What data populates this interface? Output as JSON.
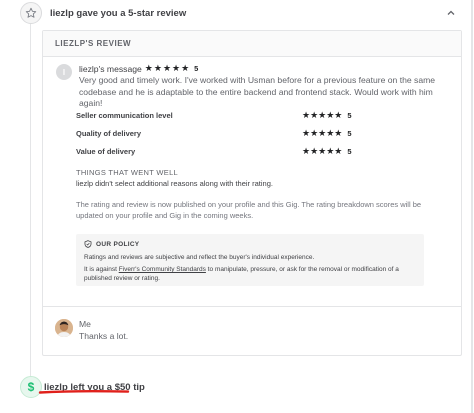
{
  "review_event": {
    "title": "liezlp gave you a 5-star review",
    "icon": "star-icon"
  },
  "review_card": {
    "header": "LIEZLP'S REVIEW",
    "reviewer_initial": "l",
    "message_label": "liezlp's message",
    "overall_rating": "5",
    "message": "Very good and timely work. I've worked with Usman before for a previous feature on the same codebase and he is adaptable to the entire backend and frontend stack. Would work with him again!",
    "criteria": [
      {
        "label": "Seller communication level",
        "value": "5"
      },
      {
        "label": "Quality of delivery",
        "value": "5"
      },
      {
        "label": "Value of delivery",
        "value": "5"
      }
    ],
    "went_well_title": "THINGS THAT WENT WELL",
    "went_well_text": "liezlp didn't select additional reasons along with their rating.",
    "publish_note": "The rating and review is now published on your profile and this Gig. The rating breakdown scores will be updated on your profile and Gig in the coming weeks.",
    "policy": {
      "title": "OUR POLICY",
      "line1": "Ratings and reviews are subjective and reflect the buyer's individual experience.",
      "line2_prefix": "It is against ",
      "line2_link": "Fiverr's Community Standards",
      "line2_suffix": " to manipulate, pressure, or ask for the removal or modification of a published review or rating."
    },
    "reply": {
      "author": "Me",
      "text": "Thanks a lot."
    }
  },
  "tip_event": {
    "title": "liezlp left you a $50 tip",
    "icon_glyph": "$"
  },
  "colors": {
    "star": "#222325",
    "tip_green": "#1dbf73",
    "underline_red": "#e0201b"
  }
}
